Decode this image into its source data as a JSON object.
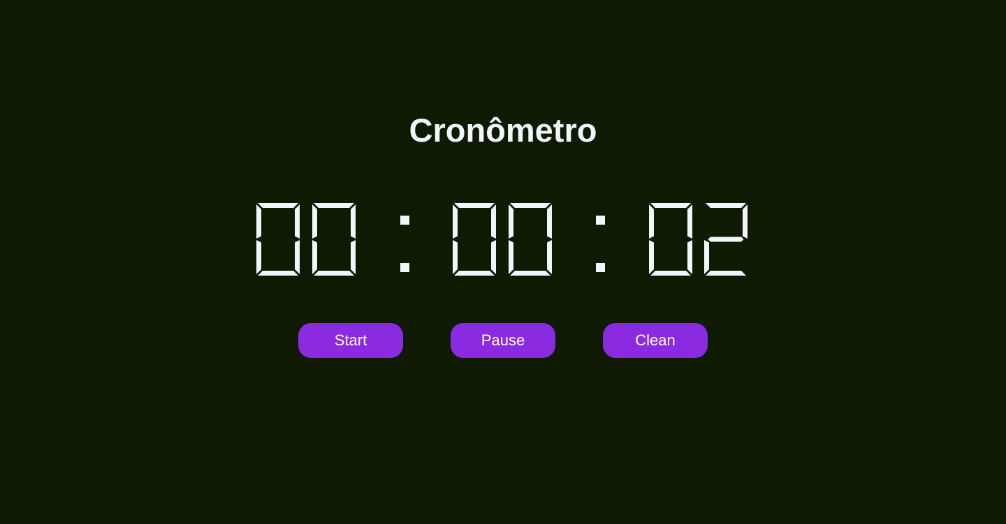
{
  "title": "Cronômetro",
  "timer": {
    "hours": "00",
    "minutes": "00",
    "seconds": "02",
    "separator": ":"
  },
  "buttons": {
    "start": "Start",
    "pause": "Pause",
    "clean": "Clean"
  },
  "colors": {
    "background": "#0f1a02",
    "text": "#f0f7fb",
    "button": "#8a2be2",
    "button_text": "#ffffff"
  }
}
